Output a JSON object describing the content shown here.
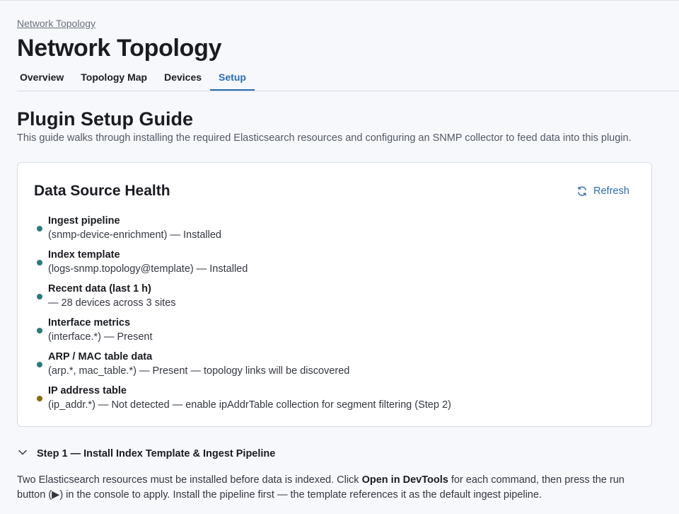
{
  "breadcrumb": "Network Topology",
  "page_title": "Network Topology",
  "tabs": [
    {
      "label": "Overview",
      "active": false
    },
    {
      "label": "Topology Map",
      "active": false
    },
    {
      "label": "Devices",
      "active": false
    },
    {
      "label": "Setup",
      "active": true
    }
  ],
  "guide": {
    "title": "Plugin Setup Guide",
    "description": "This guide walks through installing the required Elasticsearch resources and configuring an SNMP collector to feed data into this plugin."
  },
  "health": {
    "title": "Data Source Health",
    "refresh_label": "Refresh",
    "refresh_icon": "refresh-icon",
    "colors": {
      "ok": "#2a7b7c",
      "warning": "#8a6a0a"
    },
    "items": [
      {
        "title": "Ingest pipeline",
        "detail": "(snmp-device-enrichment) — Installed",
        "status": "ok"
      },
      {
        "title": "Index template",
        "detail": "(logs-snmp.topology@template) — Installed",
        "status": "ok"
      },
      {
        "title": "Recent data (last 1 h)",
        "detail": "— 28 devices across 3 sites",
        "status": "ok"
      },
      {
        "title": "Interface metrics",
        "detail": "(interface.*) — Present",
        "status": "ok"
      },
      {
        "title": "ARP / MAC table data",
        "detail": "(arp.*, mac_table.*) — Present — topology links will be discovered",
        "status": "ok"
      },
      {
        "title": "IP address table",
        "detail": "(ip_addr.*) — Not detected — enable ipAddrTable collection for segment filtering (Step 2)",
        "status": "warning"
      }
    ]
  },
  "step1": {
    "title": "Step 1 — Install Index Template & Ingest Pipeline",
    "icon": "chevron-down-icon",
    "expanded": true,
    "desc_part1": "Two Elasticsearch resources must be installed before data is indexed. Click ",
    "desc_bold": "Open in DevTools",
    "desc_part2": " for each command, then press the run button (▶) in the console to apply. Install the pipeline first — the template references it as the default ingest pipeline."
  }
}
